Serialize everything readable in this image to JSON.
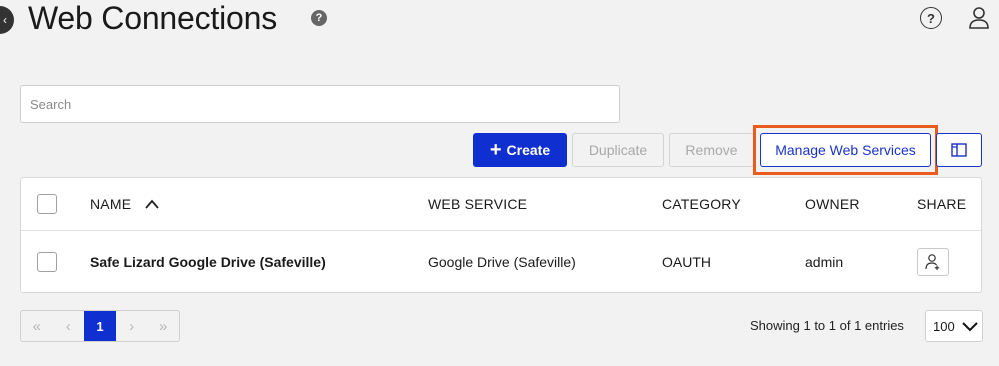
{
  "header": {
    "title": "Web Connections",
    "help_glyph": "?",
    "top_help_glyph": "?",
    "icons": [
      "back-icon",
      "help-icon",
      "user-icon"
    ]
  },
  "search": {
    "placeholder": "Search",
    "value": ""
  },
  "toolbar": {
    "create_label": "Create",
    "create_icon": "+",
    "duplicate_label": "Duplicate",
    "remove_label": "Remove",
    "manage_label": "Manage Web Services",
    "columns_icon": "columns-icon",
    "highlight_color": "#ea5b1d",
    "accent_color": "#0f2fd1"
  },
  "table": {
    "columns": [
      "NAME",
      "WEB SERVICE",
      "CATEGORY",
      "OWNER",
      "SHARE"
    ],
    "sort_column": "NAME",
    "sort_direction": "ascending",
    "rows": [
      {
        "name": "Safe Lizard Google Drive (Safeville)",
        "web_service": "Google Drive (Safeville)",
        "category": "OAUTH",
        "owner": "admin",
        "share_icon": "share-user-icon"
      }
    ]
  },
  "pagination": {
    "first": "«",
    "prev": "‹",
    "current_page": "1",
    "next": "›",
    "last": "»",
    "summary": "Showing 1 to 1 of 1 entries",
    "per_page": "100"
  }
}
